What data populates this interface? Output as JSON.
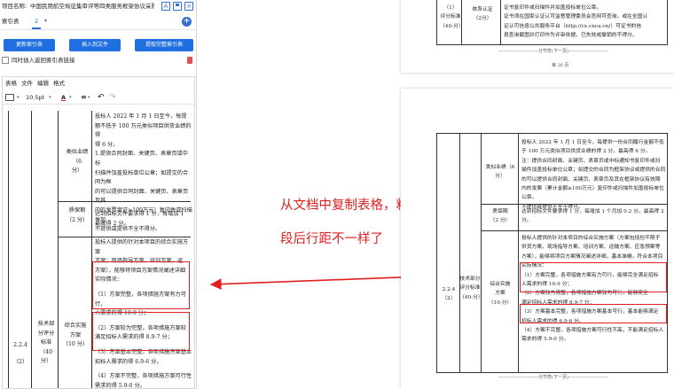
{
  "left_panel": {
    "project_label": "项目名称:",
    "project_name": "中国民用航空局征集审评等四类服务框架协议采购项目(第二",
    "tab_label": "索引表",
    "tab_count": "2",
    "tab_caret": "▾",
    "buttons": {
      "update_index": "更新索引表",
      "insert_file": "插入到文件",
      "extract_index": "提取完整索引表"
    },
    "sync_checkbox_label": "同时插入返回索引表链接",
    "editor_menu": {
      "table": "表格",
      "file": "文件",
      "edit": "编辑",
      "format": "格式"
    },
    "editor_toolbar": {
      "font_size": "10.5pt",
      "font_color_glyph": "A",
      "undo": "↶",
      "redo": "↷"
    },
    "table": {
      "p1": [
        "投标人 2022 年 1 月 1 日至今，每提",
        "额不低于 100 万元类似项目供货业绩的得",
        "得 6 分。"
      ],
      "p2": [
        "1.提供合同封面、关键页、表章页或中标",
        "扫描件加盖投标单位公章；如提交的合同为框",
        "的可以提供合同封面、关键页、表章页及其",
        "内的发票案证≥100万元）复印件或扫描件加",
        "不提供或提供不全不得分。"
      ],
      "cat_contract": [
        "类似业绩（6",
        "分）"
      ],
      "cat_warranty": "质保期",
      "cat_warranty_score": "（2 分）",
      "warranty_text": [
        "达到招标文件要求得 1 分，每增加 1",
        "最高得 2 分。"
      ],
      "plan_intro": [
        "投标人提供的针对本项目的综合实施方案",
        "方案；现场指导方案，培训方案，运",
        "方案），能够将项目方案情况阐述详细"
      ],
      "eval_label": "实际情况：",
      "item1": "（1）方案完整，各项措施方案有力可行，",
      "item1b": "人需求的得 10-9 分；",
      "item2": "（2）方案较为完整，各项措施方案较",
      "item2b": "满足招标人需求的得 8.9-7 分；",
      "item3": "（3）方案基本完整，各项措施方案基本",
      "item3b": "招标人需求的得 6.9-6 分。",
      "item4": "（4）方案不完整，各项措施方案可行性",
      "item4b": "需求的得 5.9-0 分。",
      "row_num": "2.2.4",
      "row_sub": "（2）",
      "tech_label": [
        "技术部",
        "分评分",
        "标准",
        "（40",
        "分）"
      ],
      "plan_label": [
        "综合实施",
        "方案",
        "（10 分）"
      ]
    }
  },
  "annotation": {
    "line1": "从文档中复制表格，粘贴到左侧索引表工具中时",
    "line2": "段后行距不一样了"
  },
  "right_top_page": {
    "rows": [
      "（1）",
      "评分标准",
      "（40-分）"
    ],
    "cert_label": [
      "体系认证",
      "（2分）"
    ],
    "text_lines": [
      "证书复印件或扫描件并加盖投标单位公章。",
      "证书须在国家认证认可监督管理委员会官网可查询，或在全国认",
      "证认可信息公共服务平台（http://cx.cnca.cn/）可证书的信",
      "息查询截图并打印作为评审依据，已失效或撤销的不得分。"
    ],
    "page_footer": "第 26 页",
    "page_break": "—————————分节符(下一页)—————————"
  },
  "right_bottom_page": {
    "p1": [
      "投标人 2022 年 1 月 1 日至今，每提供一份合同履行金额不低",
      "于 100 万元类似项目供货业绩的得 2 分，最高得 6 分。",
      "注：提供合同封面、关键页、表章页或中标通知书复印件或扫",
      "描件加盖投标单位公章；如提交的合同为框架协议或提供的合同",
      "的可以提供合同封面、关键页、表章页及其在框架协议有效期",
      "内的发票（累计金额≥100万元）复印件或扫描件加盖投标单位公章，",
      "不提供或提供不全不得分。"
    ],
    "cat_contract": [
      "类似业绩（6",
      "分）"
    ],
    "warranty_label": "质保期",
    "warranty_score": "（2 分）",
    "warranty_text": [
      "达到招标文件要求得 1 分，每增加 1 个月加 0.2 分，最高得 2",
      "分。"
    ],
    "plan_intro": [
      "投标人提供的针对本项目的综合实施方案（方案包括但不限于",
      "供货方案、现场指导方案、培训方案、运输方案、应急预案等",
      "方案），能够将项目方案情况阐述详细，基本准确，符合本项目"
    ],
    "eval_label": "实际情况：",
    "item1": "（1）方案完整，各项措施方案有力可行，能够完全满足招标",
    "item1b": "人需求的得 10-9 分；",
    "item2": "（2）方案较为完整，各项措施方案较为可行，能够完全",
    "item2b": "满足招标人需求的得 8.9-7 分；",
    "item3": "（3）方案基本完整，各项措施方案基本可行，基本能够满足",
    "item3b": "招标人需求的得 6.9-6 分。",
    "item4": "（4）方案不完整，各项措施方案可行性不高，不能满足招标人",
    "item4b": "需求的得 5.9-0 分。",
    "row_num": "2.2.4",
    "row_sub": "（2）",
    "tech_label": [
      "技术部分",
      "评分标准",
      "（40-分）"
    ],
    "plan_label": [
      "综合实施",
      "方案",
      "（10-分）"
    ],
    "page_break": "—————————分节符(下一页)—————————"
  },
  "colors": {
    "accent_blue": "#1f6fe0",
    "annotation_red": "#e02020"
  },
  "icons": [
    "text-style-icon",
    "save-icon",
    "close-square-icon",
    "add-circle-icon",
    "trash-icon",
    "table-icon",
    "font-color-icon",
    "align-icon",
    "undo-icon",
    "redo-icon"
  ]
}
